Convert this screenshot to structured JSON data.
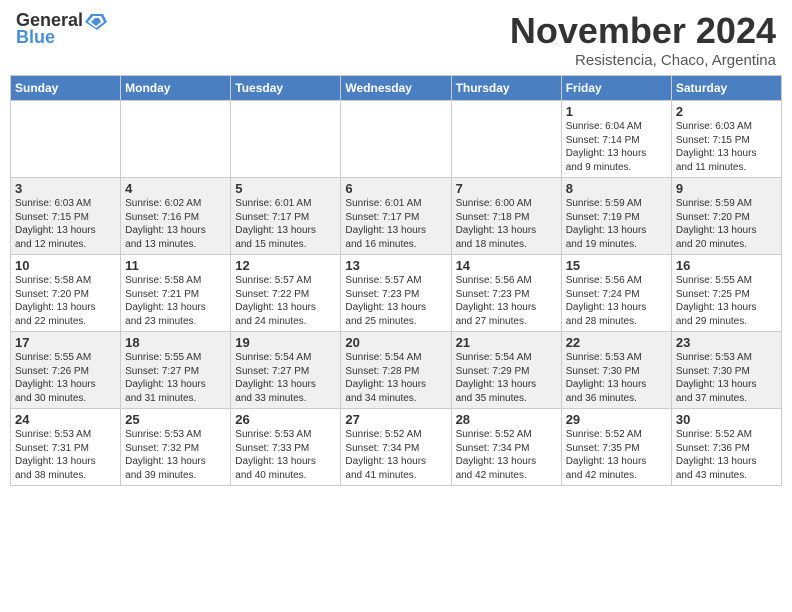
{
  "header": {
    "logo_general": "General",
    "logo_blue": "Blue",
    "month_title": "November 2024",
    "subtitle": "Resistencia, Chaco, Argentina"
  },
  "weekdays": [
    "Sunday",
    "Monday",
    "Tuesday",
    "Wednesday",
    "Thursday",
    "Friday",
    "Saturday"
  ],
  "weeks": [
    [
      {
        "day": "",
        "info": ""
      },
      {
        "day": "",
        "info": ""
      },
      {
        "day": "",
        "info": ""
      },
      {
        "day": "",
        "info": ""
      },
      {
        "day": "",
        "info": ""
      },
      {
        "day": "1",
        "info": "Sunrise: 6:04 AM\nSunset: 7:14 PM\nDaylight: 13 hours\nand 9 minutes."
      },
      {
        "day": "2",
        "info": "Sunrise: 6:03 AM\nSunset: 7:15 PM\nDaylight: 13 hours\nand 11 minutes."
      }
    ],
    [
      {
        "day": "3",
        "info": "Sunrise: 6:03 AM\nSunset: 7:15 PM\nDaylight: 13 hours\nand 12 minutes."
      },
      {
        "day": "4",
        "info": "Sunrise: 6:02 AM\nSunset: 7:16 PM\nDaylight: 13 hours\nand 13 minutes."
      },
      {
        "day": "5",
        "info": "Sunrise: 6:01 AM\nSunset: 7:17 PM\nDaylight: 13 hours\nand 15 minutes."
      },
      {
        "day": "6",
        "info": "Sunrise: 6:01 AM\nSunset: 7:17 PM\nDaylight: 13 hours\nand 16 minutes."
      },
      {
        "day": "7",
        "info": "Sunrise: 6:00 AM\nSunset: 7:18 PM\nDaylight: 13 hours\nand 18 minutes."
      },
      {
        "day": "8",
        "info": "Sunrise: 5:59 AM\nSunset: 7:19 PM\nDaylight: 13 hours\nand 19 minutes."
      },
      {
        "day": "9",
        "info": "Sunrise: 5:59 AM\nSunset: 7:20 PM\nDaylight: 13 hours\nand 20 minutes."
      }
    ],
    [
      {
        "day": "10",
        "info": "Sunrise: 5:58 AM\nSunset: 7:20 PM\nDaylight: 13 hours\nand 22 minutes."
      },
      {
        "day": "11",
        "info": "Sunrise: 5:58 AM\nSunset: 7:21 PM\nDaylight: 13 hours\nand 23 minutes."
      },
      {
        "day": "12",
        "info": "Sunrise: 5:57 AM\nSunset: 7:22 PM\nDaylight: 13 hours\nand 24 minutes."
      },
      {
        "day": "13",
        "info": "Sunrise: 5:57 AM\nSunset: 7:23 PM\nDaylight: 13 hours\nand 25 minutes."
      },
      {
        "day": "14",
        "info": "Sunrise: 5:56 AM\nSunset: 7:23 PM\nDaylight: 13 hours\nand 27 minutes."
      },
      {
        "day": "15",
        "info": "Sunrise: 5:56 AM\nSunset: 7:24 PM\nDaylight: 13 hours\nand 28 minutes."
      },
      {
        "day": "16",
        "info": "Sunrise: 5:55 AM\nSunset: 7:25 PM\nDaylight: 13 hours\nand 29 minutes."
      }
    ],
    [
      {
        "day": "17",
        "info": "Sunrise: 5:55 AM\nSunset: 7:26 PM\nDaylight: 13 hours\nand 30 minutes."
      },
      {
        "day": "18",
        "info": "Sunrise: 5:55 AM\nSunset: 7:27 PM\nDaylight: 13 hours\nand 31 minutes."
      },
      {
        "day": "19",
        "info": "Sunrise: 5:54 AM\nSunset: 7:27 PM\nDaylight: 13 hours\nand 33 minutes."
      },
      {
        "day": "20",
        "info": "Sunrise: 5:54 AM\nSunset: 7:28 PM\nDaylight: 13 hours\nand 34 minutes."
      },
      {
        "day": "21",
        "info": "Sunrise: 5:54 AM\nSunset: 7:29 PM\nDaylight: 13 hours\nand 35 minutes."
      },
      {
        "day": "22",
        "info": "Sunrise: 5:53 AM\nSunset: 7:30 PM\nDaylight: 13 hours\nand 36 minutes."
      },
      {
        "day": "23",
        "info": "Sunrise: 5:53 AM\nSunset: 7:30 PM\nDaylight: 13 hours\nand 37 minutes."
      }
    ],
    [
      {
        "day": "24",
        "info": "Sunrise: 5:53 AM\nSunset: 7:31 PM\nDaylight: 13 hours\nand 38 minutes."
      },
      {
        "day": "25",
        "info": "Sunrise: 5:53 AM\nSunset: 7:32 PM\nDaylight: 13 hours\nand 39 minutes."
      },
      {
        "day": "26",
        "info": "Sunrise: 5:53 AM\nSunset: 7:33 PM\nDaylight: 13 hours\nand 40 minutes."
      },
      {
        "day": "27",
        "info": "Sunrise: 5:52 AM\nSunset: 7:34 PM\nDaylight: 13 hours\nand 41 minutes."
      },
      {
        "day": "28",
        "info": "Sunrise: 5:52 AM\nSunset: 7:34 PM\nDaylight: 13 hours\nand 42 minutes."
      },
      {
        "day": "29",
        "info": "Sunrise: 5:52 AM\nSunset: 7:35 PM\nDaylight: 13 hours\nand 42 minutes."
      },
      {
        "day": "30",
        "info": "Sunrise: 5:52 AM\nSunset: 7:36 PM\nDaylight: 13 hours\nand 43 minutes."
      }
    ]
  ]
}
